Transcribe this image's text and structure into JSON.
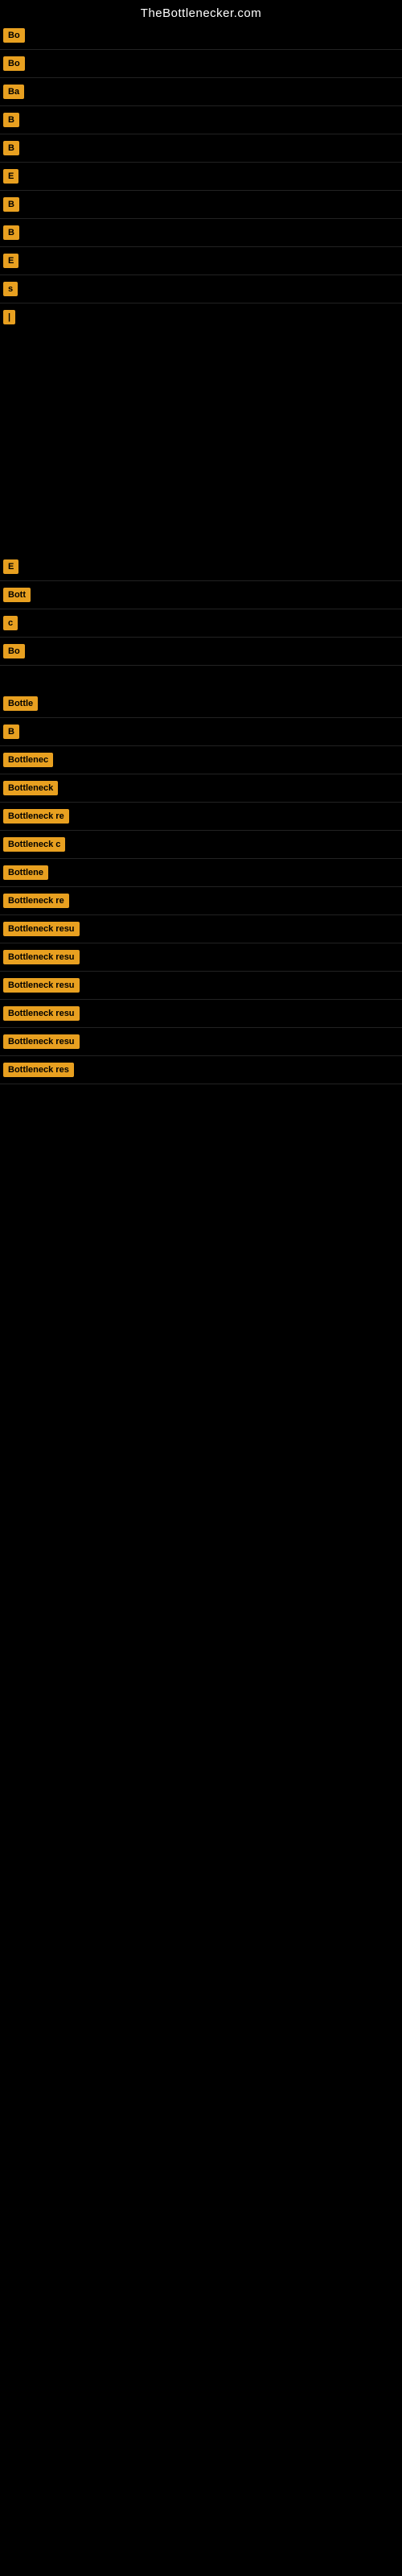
{
  "site": {
    "title": "TheBottlenecker.com"
  },
  "rows": [
    {
      "badge": "Bo",
      "text": ""
    },
    {
      "badge": "Bo",
      "text": ""
    },
    {
      "badge": "Ba",
      "text": ""
    },
    {
      "badge": "B",
      "text": ""
    },
    {
      "badge": "B",
      "text": ""
    },
    {
      "badge": "E",
      "text": ""
    },
    {
      "badge": "B",
      "text": ""
    },
    {
      "badge": "B",
      "text": ""
    },
    {
      "badge": "E",
      "text": ""
    },
    {
      "badge": "s",
      "text": ""
    },
    {
      "badge": "|",
      "text": ""
    }
  ],
  "bottom_rows": [
    {
      "badge": "E",
      "text": ""
    },
    {
      "badge": "Bott",
      "text": ""
    },
    {
      "badge": "c",
      "text": ""
    },
    {
      "badge": "Bo",
      "text": ""
    },
    {
      "gap": true
    },
    {
      "badge": "Bottle",
      "text": ""
    },
    {
      "badge": "B",
      "text": ""
    },
    {
      "badge": "Bottlenec",
      "text": ""
    },
    {
      "badge": "Bottleneck",
      "text": ""
    },
    {
      "badge": "Bottleneck re",
      "text": ""
    },
    {
      "badge": "Bottleneck c",
      "text": ""
    },
    {
      "badge": "Bottlene",
      "text": ""
    },
    {
      "badge": "Bottleneck re",
      "text": ""
    },
    {
      "badge": "Bottleneck resu",
      "text": ""
    },
    {
      "badge": "Bottleneck resu",
      "text": ""
    },
    {
      "badge": "Bottleneck resu",
      "text": ""
    },
    {
      "badge": "Bottleneck resu",
      "text": ""
    },
    {
      "badge": "Bottleneck resu",
      "text": ""
    },
    {
      "badge": "Bottleneck res",
      "text": ""
    }
  ]
}
